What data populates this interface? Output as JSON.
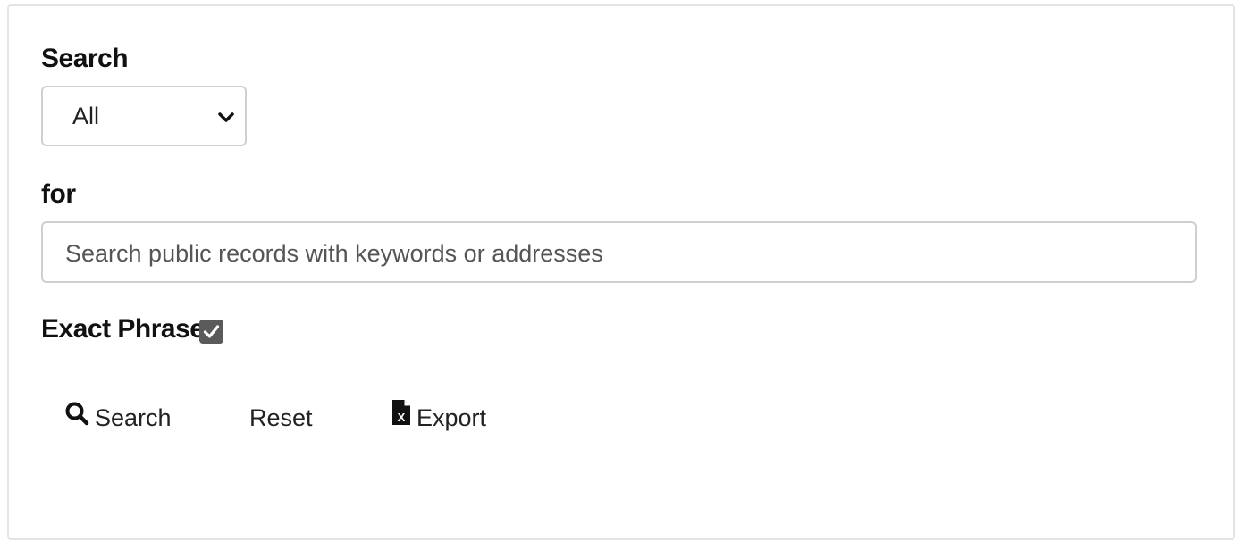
{
  "form": {
    "search_label": "Search",
    "scope_select": {
      "selected": "All"
    },
    "for_label": "for",
    "query_input": {
      "value": "",
      "placeholder": "Search public records with keywords or addresses"
    },
    "exact_phrase": {
      "label": "Exact Phrase",
      "checked": true
    }
  },
  "actions": {
    "search_label": "Search",
    "search_icon": "search-icon",
    "reset_label": "Reset",
    "export_label": "Export",
    "export_icon": "excel-file-icon"
  },
  "colors": {
    "border": "#cfcfcf",
    "checkbox": "#5a5a5a",
    "text": "#222222",
    "placeholder": "#555555"
  }
}
